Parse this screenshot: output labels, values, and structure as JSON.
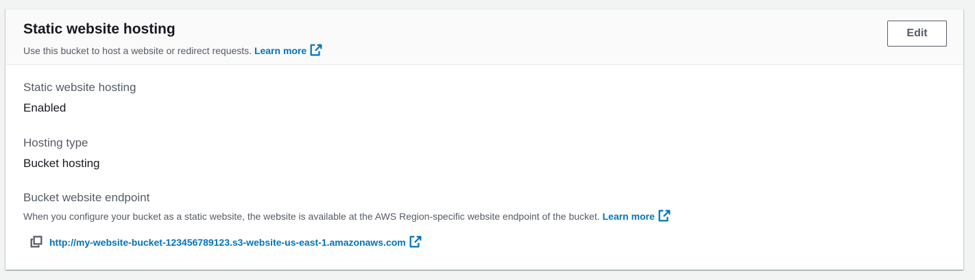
{
  "header": {
    "title": "Static website hosting",
    "description": "Use this bucket to host a website or redirect requests.",
    "learn_more": "Learn more",
    "edit_label": "Edit"
  },
  "details": {
    "hosting": {
      "label": "Static website hosting",
      "value": "Enabled"
    },
    "hosting_type": {
      "label": "Hosting type",
      "value": "Bucket hosting"
    },
    "endpoint": {
      "label": "Bucket website endpoint",
      "description": "When you configure your bucket as a static website, the website is available at the AWS Region-specific website endpoint of the bucket.",
      "learn_more": "Learn more",
      "url": "http://my-website-bucket-123456789123.s3-website-us-east-1.amazonaws.com"
    }
  },
  "colors": {
    "link": "#0073bb",
    "text": "#16191f",
    "muted": "#545b64",
    "header_bg": "#fafafa",
    "page_bg": "#f2f3f3"
  },
  "icons": {
    "external": "external-link-icon",
    "copy": "copy-icon"
  }
}
